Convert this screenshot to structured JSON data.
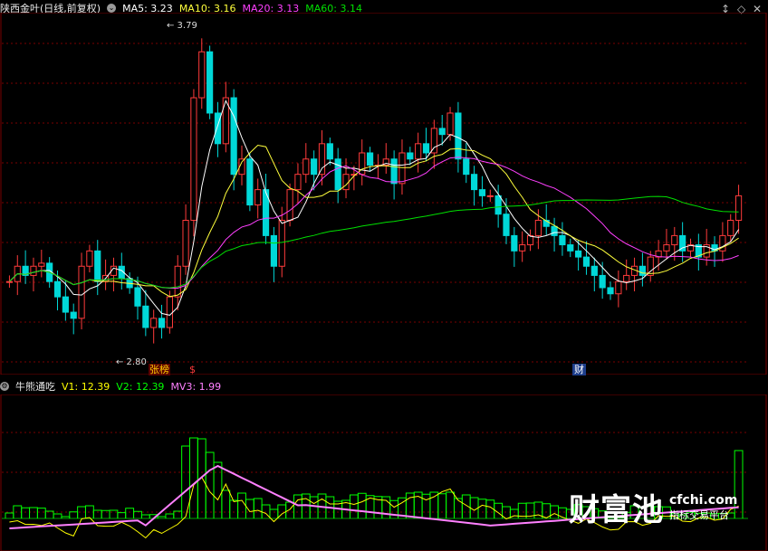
{
  "header": {
    "title": "陕西金叶(日线,前复权)",
    "ma5_label": "MA5: 3.23",
    "ma10_label": "MA10: 3.16",
    "ma20_label": "MA20: 3.13",
    "ma60_label": "MA60: 3.14",
    "dropdown_glyph": "⌄"
  },
  "indicator": {
    "name": "牛熊通吃",
    "v1_label": "V1: 12.39",
    "v2_label": "V2: 12.39",
    "mv3_label": "MV3: 1.99"
  },
  "annotations": {
    "high": "3.79",
    "low": "2.80",
    "tag_zhangbang": "张榜",
    "tag_dollar": "$",
    "tag_cai": "财"
  },
  "controls": {
    "pin": "↕",
    "diamond": "◇",
    "close": "✕"
  },
  "watermark": {
    "brand": "财富池",
    "url": "cfchi.com",
    "sub": "指标交易平台"
  },
  "colors": {
    "up": "#ff3b3b",
    "down": "#00d8d8",
    "ma5": "#ffffff",
    "ma10": "#ffff3c",
    "ma20": "#ff40ff",
    "ma60": "#00e000",
    "grid": "#7a0000",
    "ind_bar": "#00ff00",
    "ind_v": "#ffff00",
    "ind_mv": "#ff80ff"
  },
  "chart_data": [
    {
      "type": "candlestick",
      "title": "陕西金叶(日线,前复权)",
      "ylim": [
        2.8,
        3.79
      ],
      "close_path": [
        3.0,
        3.05,
        3.02,
        3.05,
        3.06,
        3.0,
        2.95,
        2.9,
        2.88,
        3.05,
        3.1,
        3.0,
        3.02,
        3.05,
        3.01,
        2.98,
        2.92,
        2.85,
        2.88,
        2.85,
        2.95,
        3.05,
        3.2,
        3.6,
        3.75,
        3.55,
        3.45,
        3.6,
        3.35,
        3.4,
        3.25,
        3.3,
        3.15,
        3.05,
        3.2,
        3.3,
        3.35,
        3.4,
        3.35,
        3.45,
        3.4,
        3.3,
        3.35,
        3.35,
        3.42,
        3.38,
        3.38,
        3.4,
        3.32,
        3.42,
        3.4,
        3.45,
        3.42,
        3.5,
        3.48,
        3.55,
        3.4,
        3.35,
        3.3,
        3.28,
        3.28,
        3.22,
        3.15,
        3.1,
        3.12,
        3.15,
        3.2,
        3.18,
        3.15,
        3.12,
        3.1,
        3.08,
        3.05,
        3.02,
        2.98,
        2.96,
        3.0,
        3.02,
        3.05,
        3.02,
        3.08,
        3.1,
        3.12,
        3.15,
        3.1,
        3.12,
        3.08,
        3.12,
        3.1,
        3.15,
        3.2,
        3.28
      ],
      "ma_lines": [
        "MA5",
        "MA10",
        "MA20",
        "MA60"
      ]
    },
    {
      "type": "bar",
      "title": "牛熊通吃",
      "series": [
        {
          "name": "V1",
          "last": 12.39
        },
        {
          "name": "V2",
          "last": 12.39
        },
        {
          "name": "MV3",
          "last": 1.99
        }
      ]
    }
  ]
}
